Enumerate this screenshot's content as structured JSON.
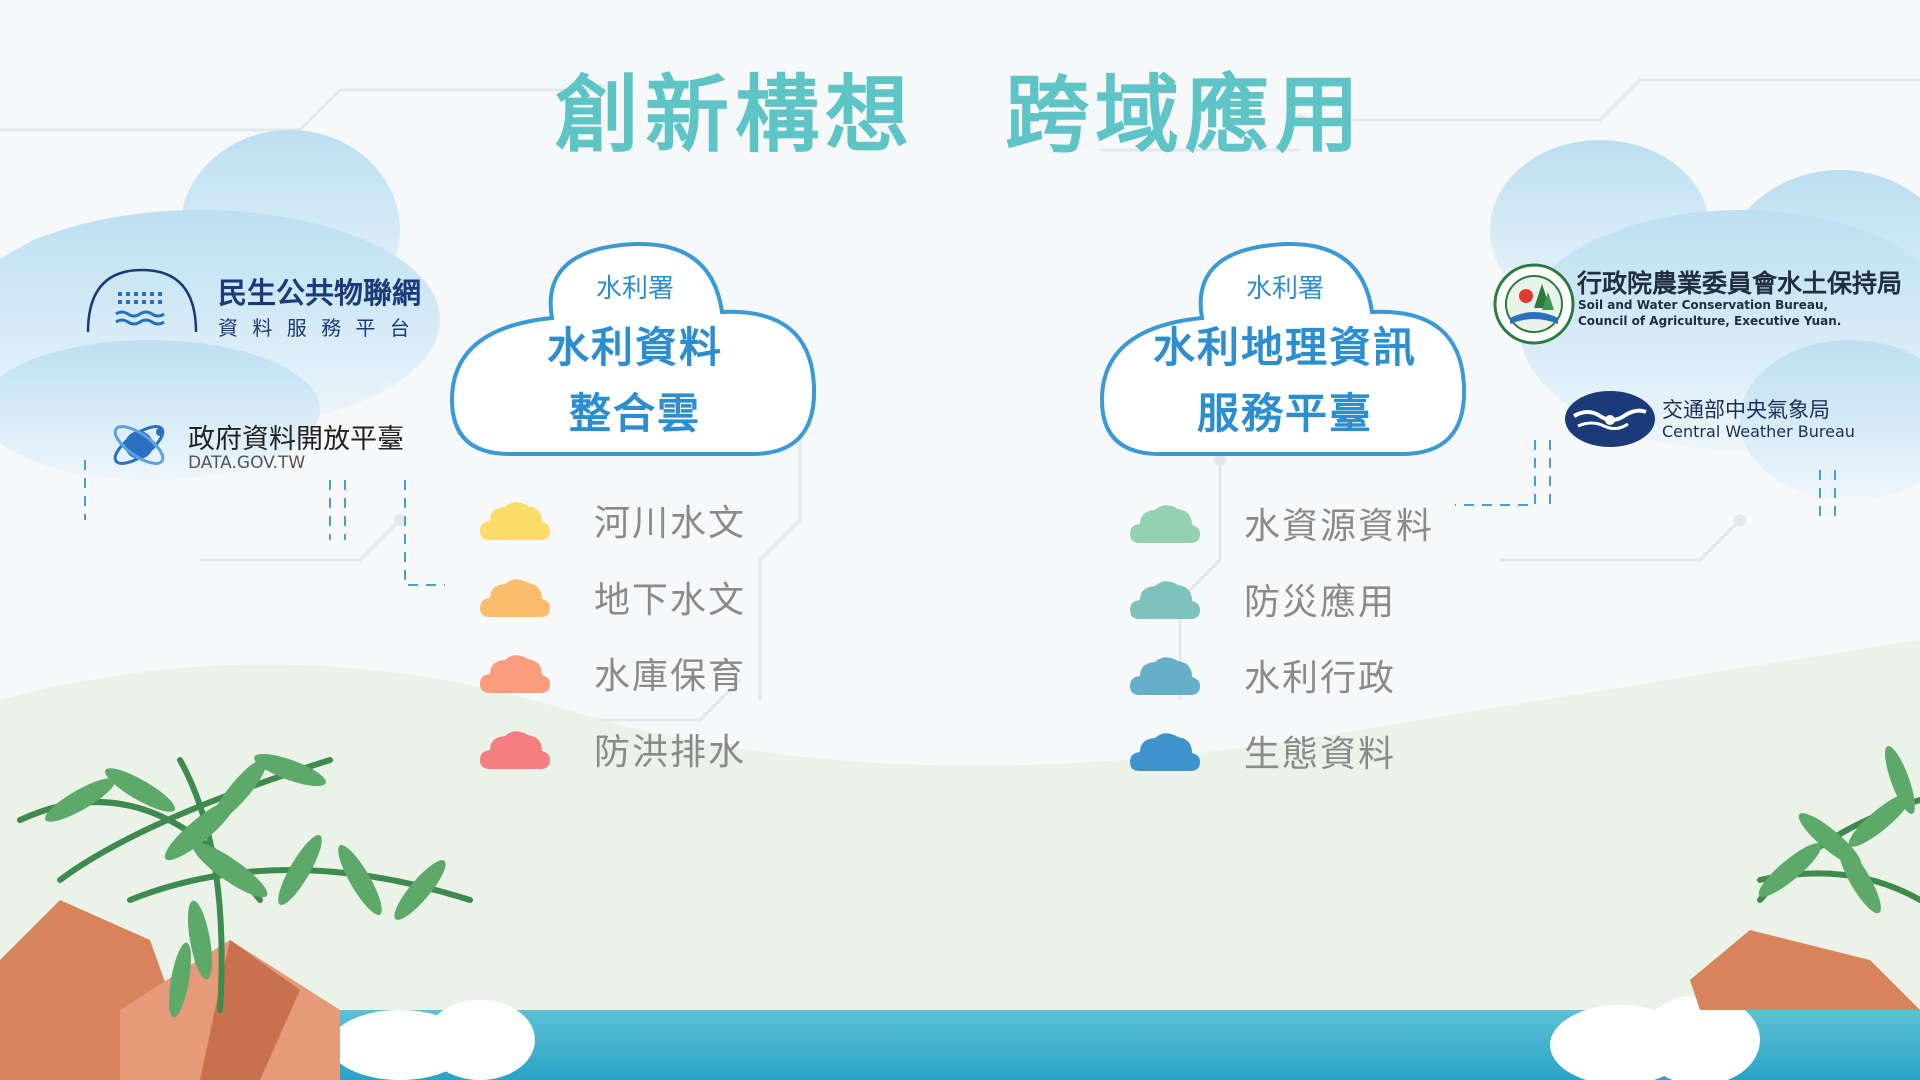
{
  "title": "創新構想　跨域應用",
  "colors": {
    "teal": "#5ec4c6",
    "cloud_border": "#3b9ad5",
    "cloud_text": "#2c8ed0",
    "navy": "#1a3a7a"
  },
  "left_logos": {
    "iot": {
      "name": "民生公共物聯網",
      "sub": "資 料 服 務 平 台"
    },
    "gov": {
      "name": "政府資料開放平臺",
      "sub": "DATA.GOV.TW"
    }
  },
  "right_logos": {
    "swcb": {
      "name": "行政院農業委員會水土保持局",
      "en1": "Soil and Water Conservation Bureau,",
      "en2": "Council of Agriculture, Executive Yuan."
    },
    "cwb": {
      "name": "交通部中央氣象局",
      "en": "Central Weather Bureau"
    }
  },
  "left_cloud": {
    "agency": "水利署",
    "line1": "水利資料",
    "line2": "整合雲"
  },
  "right_cloud": {
    "agency": "水利署",
    "line1": "水利地理資訊",
    "line2": "服務平臺"
  },
  "left_items": [
    {
      "label": "河川水文",
      "color": "#fbdc68"
    },
    {
      "label": "地下水文",
      "color": "#fbbd6c"
    },
    {
      "label": "水庫保育",
      "color": "#f99d7c"
    },
    {
      "label": "防洪排水",
      "color": "#f57f80"
    }
  ],
  "right_items": [
    {
      "label": "水資源資料",
      "color": "#93d1b1"
    },
    {
      "label": "防災應用",
      "color": "#7dc2bd"
    },
    {
      "label": "水利行政",
      "color": "#66afc8"
    },
    {
      "label": "生態資料",
      "color": "#3f93cc"
    }
  ]
}
